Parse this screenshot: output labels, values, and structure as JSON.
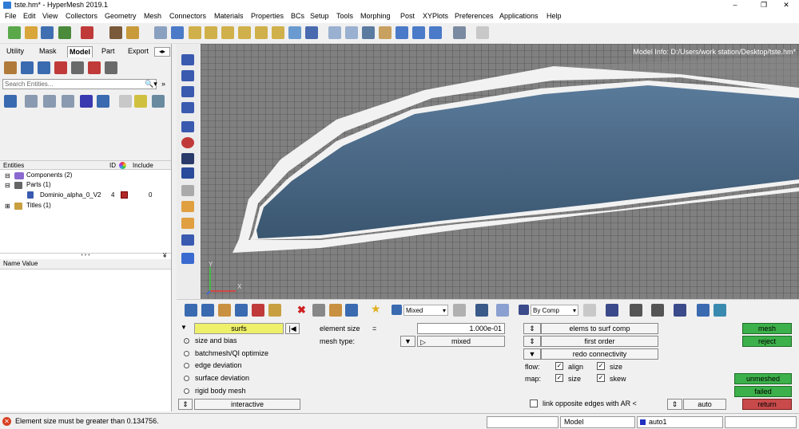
{
  "window": {
    "title": "tste.hm* - HyperMesh 2019.1",
    "minimize": "–",
    "maximize": "❐",
    "close": "✕"
  },
  "menu": [
    "File",
    "Edit",
    "View",
    "Collectors",
    "Geometry",
    "Mesh",
    "Connectors",
    "Materials",
    "Properties",
    "BCs",
    "Setup",
    "Tools",
    "Morphing",
    "Post",
    "XYPlots",
    "Preferences",
    "Applications",
    "Help"
  ],
  "left": {
    "tabs": [
      "Utility",
      "Mask",
      "Model",
      "Part",
      "Export"
    ],
    "search_placeholder": "Search Entities...",
    "tree_headers": {
      "entities": "Entities",
      "id": "ID",
      "include": "Include"
    },
    "tree": {
      "components": "Components (2)",
      "parts": "Parts (1)",
      "part_name": "Dominio_alpha_0_V2",
      "part_id": "4",
      "part_include": "0",
      "titles": "Titles (1)"
    },
    "name_value": "Name Value"
  },
  "canvas": {
    "model_info": "Model Info: D:/Users/work station/Desktop/tste.hm*",
    "axis_y": "Y",
    "axis_x": "X"
  },
  "bottomtb": {
    "mixed": "Mixed",
    "bycomp": "By Comp"
  },
  "panel": {
    "surfs": "surfs",
    "radios": [
      "size and bias",
      "batchmesh/QI optimize",
      "edge deviation",
      "surface deviation",
      "rigid body mesh"
    ],
    "interactive": "interactive",
    "element_size_label": "element size",
    "equals": "=",
    "element_size_value": "1.000e-01",
    "mesh_type_label": "mesh type:",
    "mesh_type_value": "mixed",
    "elems_btn": "elems to surf comp",
    "order_btn": "first order",
    "redo_btn": "redo connectivity",
    "flow_label": "flow:",
    "map_label": "map:",
    "align": "align",
    "size1": "size",
    "size2": "size",
    "skew": "skew",
    "link_label": "link opposite edges with AR <",
    "auto": "auto",
    "mesh": "mesh",
    "reject": "reject",
    "unmeshed": "unmeshed",
    "failed": "failed",
    "return": "return"
  },
  "status": {
    "message": "Element size must be greater than 0.134756.",
    "model": "Model",
    "auto": "auto1"
  }
}
